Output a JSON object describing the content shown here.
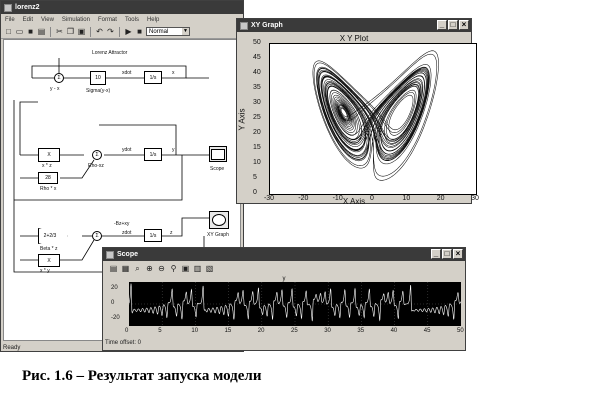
{
  "model_window": {
    "title": "lorenz2",
    "menu": [
      "File",
      "Edit",
      "View",
      "Simulation",
      "Format",
      "Tools",
      "Help"
    ],
    "toolbar_icons": [
      "new-icon",
      "open-icon",
      "save-icon",
      "print-icon",
      "cut-icon",
      "copy-icon",
      "paste-icon",
      "undo-icon",
      "redo-icon",
      "play-icon",
      "stop-icon"
    ],
    "sim_mode": "Normal",
    "status": "Ready",
    "diagram": {
      "title": "Lorenz Attractor",
      "labels": {
        "y_minus_x": "y - x",
        "sigma": "Sigma(y-x)",
        "gain10": "10",
        "xdot": "xdot",
        "x": "x",
        "integrator": "1/s",
        "ydot": "ydot",
        "y": "y",
        "xz": "x * z",
        "rho_block": "28",
        "rho_label": "Rho * x",
        "rho_xz": "Rho-xz",
        "scope": "Scope",
        "zdot_expr": "-Bz+xy",
        "zdot": "zdot",
        "z": "z",
        "beta_block": "2+2/3",
        "beta_label": "Beta * z",
        "xy": "x * y",
        "xy_graph": "XY Graph",
        "times": "X"
      }
    }
  },
  "xy_window": {
    "title": "XY Graph",
    "plot_title": "X Y Plot",
    "xlabel": "X Axis",
    "ylabel": "Y Axis",
    "xticks": [
      "-30",
      "-20",
      "-10",
      "0",
      "10",
      "20",
      "30"
    ],
    "yticks": [
      "50",
      "45",
      "40",
      "35",
      "30",
      "25",
      "20",
      "15",
      "10",
      "5",
      "0"
    ],
    "xlim": [
      -30,
      30
    ],
    "ylim": [
      0,
      50
    ]
  },
  "scope_window": {
    "title": "Scope",
    "toolbar_icons": [
      "print-icon",
      "parameters-icon",
      "zoom-icon",
      "zoom-x-icon",
      "zoom-y-icon",
      "autoscale-icon",
      "save-axes-icon",
      "restore-axes-icon",
      "floating-scope-icon"
    ],
    "plot_title": "y",
    "yticks": [
      "20",
      "0",
      "-20"
    ],
    "xticks": [
      "0",
      "5",
      "10",
      "15",
      "20",
      "25",
      "30",
      "35",
      "40",
      "45",
      "50"
    ],
    "time_offset": "Time offset:  0"
  },
  "caption": "Рис. 1.6 – Результат запуска модели",
  "chart_data": [
    {
      "type": "line",
      "title": "X Y Plot",
      "xlabel": "X Axis",
      "ylabel": "Y Axis",
      "xlim": [
        -30,
        30
      ],
      "ylim": [
        0,
        50
      ],
      "description_type": "Lorenz attractor trajectory (butterfly), lobes centered near (-8,27) and (8,27)"
    },
    {
      "type": "line",
      "title": "y",
      "xlim": [
        0,
        50
      ],
      "ylim": [
        -30,
        30
      ],
      "description_type": "Lorenz y(t) oscillation"
    }
  ]
}
